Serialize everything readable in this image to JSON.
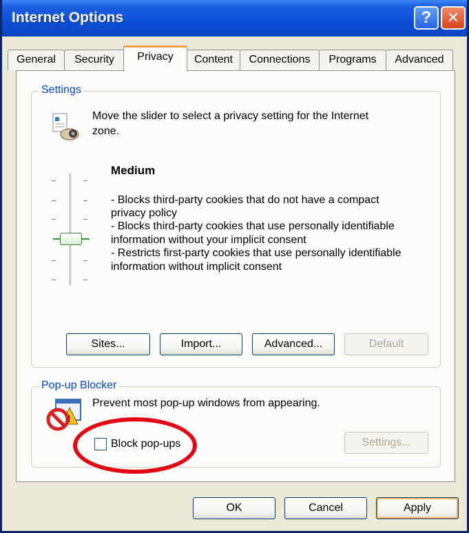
{
  "window": {
    "title": "Internet Options",
    "help_glyph": "?",
    "close_glyph": "✕"
  },
  "tabs": [
    "General",
    "Security",
    "Privacy",
    "Content",
    "Connections",
    "Programs",
    "Advanced"
  ],
  "active_tab": "Privacy",
  "settings": {
    "group_label": "Settings",
    "instruction_line1": "Move the slider to select a privacy setting for the Internet",
    "instruction_line2": "zone.",
    "level_title": "Medium",
    "desc_lines": [
      "- Blocks third-party cookies that do not have a compact",
      "privacy policy",
      "- Blocks third-party cookies that use personally identifiable",
      "information without your implicit consent",
      "- Restricts first-party cookies that use personally identifiable",
      "information without implicit consent"
    ],
    "slider_level": 3,
    "slider_levels": 6,
    "buttons": {
      "sites": "Sites...",
      "import": "Import...",
      "advanced": "Advanced...",
      "default": "Default"
    },
    "icon": "privacy-zone-icon"
  },
  "popup_blocker": {
    "group_label": "Pop-up Blocker",
    "description": "Prevent most pop-up windows from appearing.",
    "checkbox_label": "Block pop-ups",
    "checked": false,
    "settings_button": "Settings...",
    "icon": "popup-blocked-icon"
  },
  "footer": {
    "ok": "OK",
    "cancel": "Cancel",
    "apply": "Apply"
  },
  "colors": {
    "titlebar": "#0c4fd8",
    "group_label": "#0046d5",
    "highlight_circle": "#e30613",
    "active_tab_accent": "#f0a24a"
  }
}
